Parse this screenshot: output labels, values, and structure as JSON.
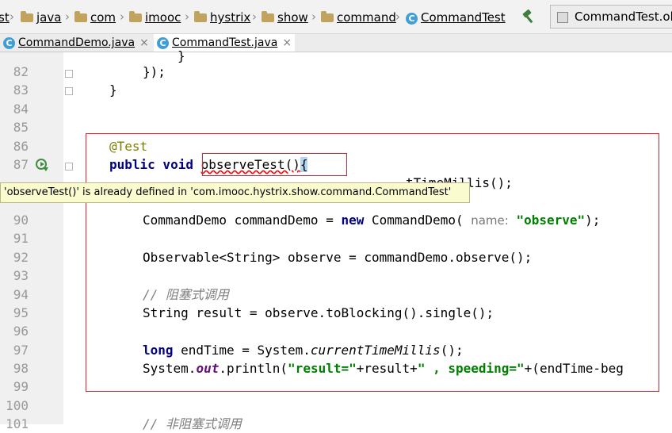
{
  "breadcrumbs": [
    {
      "label": "st",
      "icon": "none"
    },
    {
      "label": "java",
      "icon": "folder-icon"
    },
    {
      "label": "com",
      "icon": "folder-icon"
    },
    {
      "label": "imooc",
      "icon": "folder-icon"
    },
    {
      "label": "hystrix",
      "icon": "folder-icon"
    },
    {
      "label": "show",
      "icon": "folder-icon"
    },
    {
      "label": "command",
      "icon": "folder-icon"
    },
    {
      "label": "CommandTest",
      "icon": "class-icon"
    }
  ],
  "run_config": {
    "label": "CommandTest.obs"
  },
  "tabs": [
    {
      "label": "CommandDemo.java",
      "close": "×",
      "active": false
    },
    {
      "label": "CommandTest.java",
      "close": "×",
      "active": true
    }
  ],
  "class_icon_letter": "C",
  "line_numbers": [
    "82",
    "83",
    "84",
    "85",
    "86",
    "87",
    "",
    "90",
    "91",
    "92",
    "93",
    "94",
    "95",
    "96",
    "97",
    "98",
    "99",
    "100",
    "101"
  ],
  "code": {
    "l81": "}",
    "l82": "});",
    "l83": "}",
    "l86": "@Test",
    "l87_kw": "public void",
    "l87_name": "observeTest()",
    "l87_brace": "{",
    "l88_tail": "tTimeMillis();",
    "l90_a": "CommandDemo commandDemo = ",
    "l90_new": "new",
    "l90_b": " CommandDemo(",
    "l90_hint": "name:",
    "l90_str": "\"observe\"",
    "l90_c": ");",
    "l92": "Observable<String> observe = commandDemo.observe();",
    "l94": "// 阻塞式调用",
    "l95": "String result = observe.toBlocking().single();",
    "l97_kw": "long",
    "l97_a": " endTime = System.",
    "l97_m": "currentTimeMillis",
    "l97_b": "();",
    "l98_a": "System.",
    "l98_out": "out",
    "l98_b": ".println(",
    "l98_s1": "\"result=\"",
    "l98_c": "+result+",
    "l98_s2": "\" , speeding=\"",
    "l98_d": "+(endTime-beg",
    "l101": "// 非阻塞式调用"
  },
  "tooltip": "'observeTest()' is already defined in 'com.imooc.hystrix.show.command.CommandTest'",
  "colors": {
    "error_box": "#e0202a",
    "keyword": "#000080",
    "string": "#008000",
    "annotation": "#808000",
    "comment": "#808080"
  }
}
